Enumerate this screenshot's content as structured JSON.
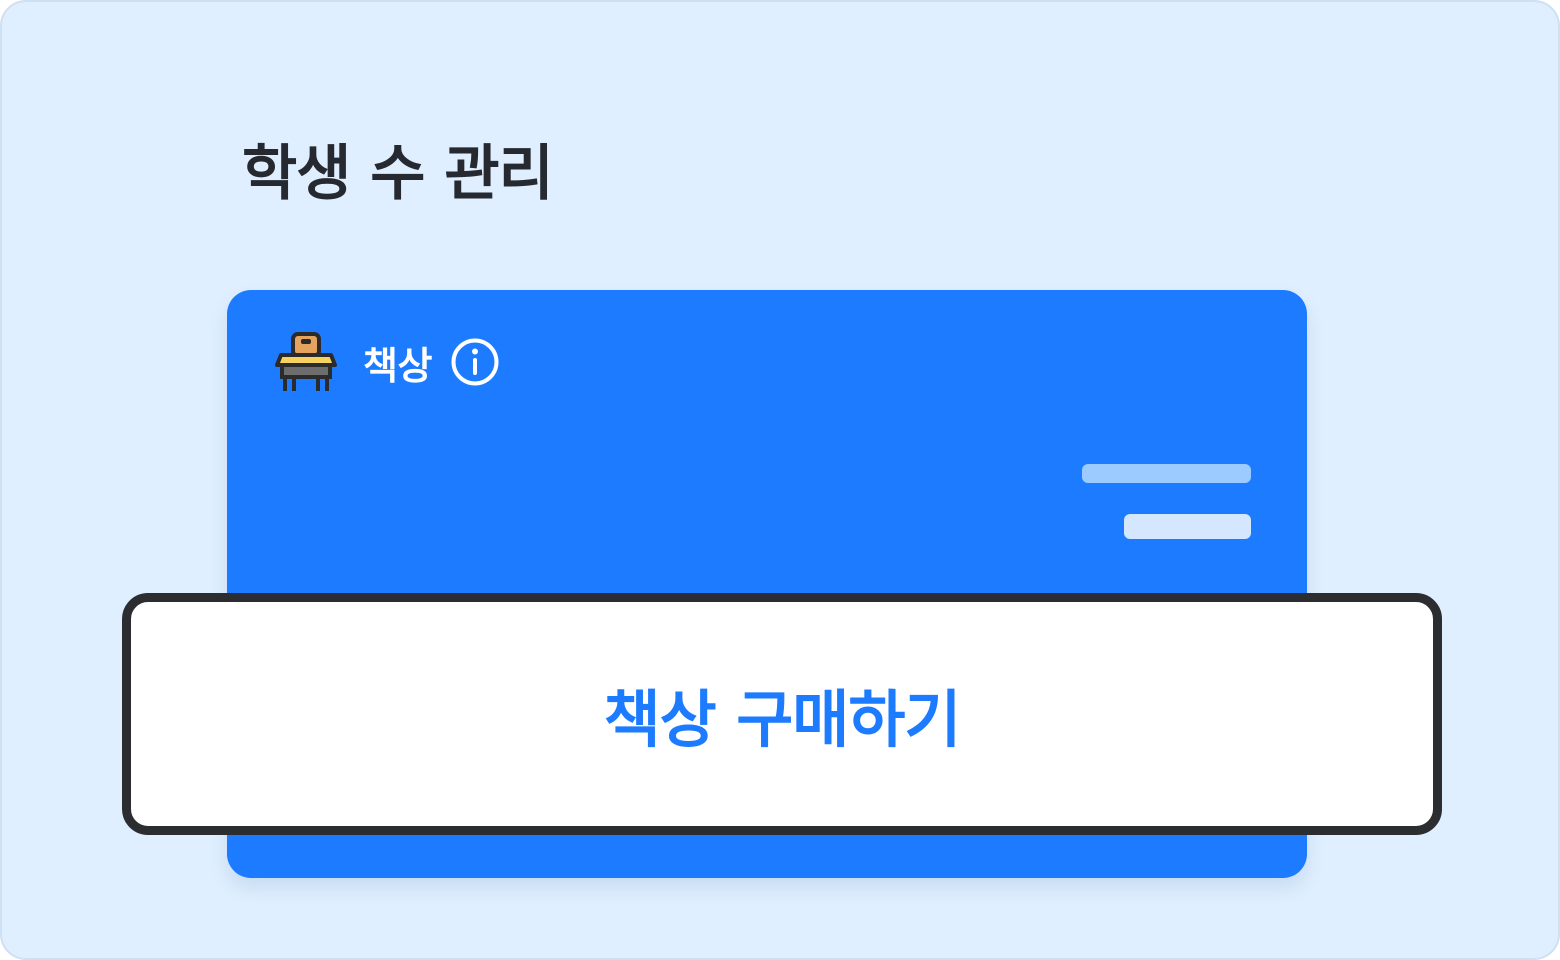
{
  "page": {
    "title": "학생 수 관리"
  },
  "card": {
    "icon": "school-desk-icon",
    "label": "책상",
    "info_icon": "info-icon"
  },
  "button": {
    "label": "책상 구매하기"
  },
  "colors": {
    "background": "#dfefff",
    "card": "#1c7bff",
    "accent_text": "#1c7bff",
    "button_border": "#2c2d31",
    "title_text": "#262a30"
  }
}
